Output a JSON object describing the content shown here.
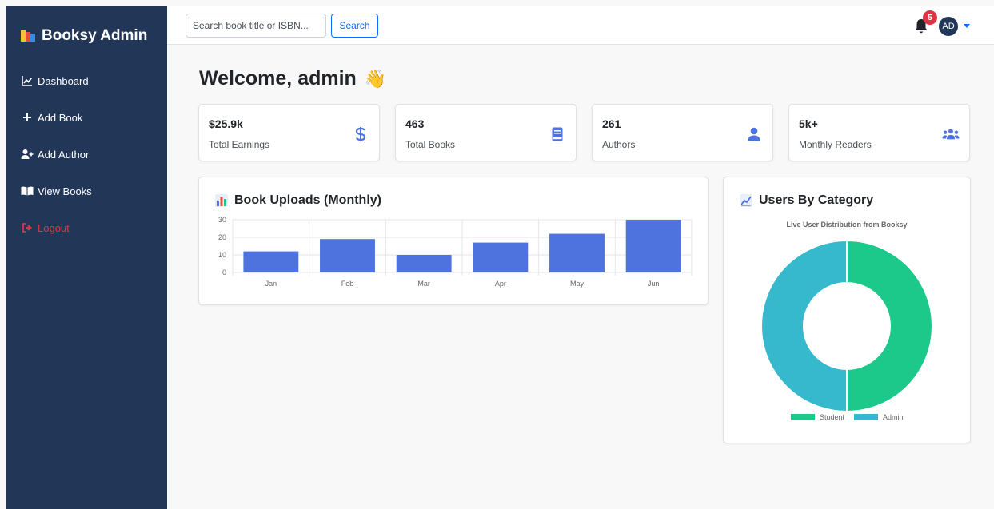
{
  "brand": {
    "name": "Booksy Admin"
  },
  "sidebar": {
    "items": [
      {
        "label": "Dashboard",
        "icon": "chart-line-icon"
      },
      {
        "label": "Add Book",
        "icon": "plus-icon"
      },
      {
        "label": "Add Author",
        "icon": "user-plus-icon"
      },
      {
        "label": "View Books",
        "icon": "book-open-icon"
      },
      {
        "label": "Logout",
        "icon": "logout-icon"
      }
    ]
  },
  "topbar": {
    "search_placeholder": "Search book title or ISBN...",
    "search_button": "Search",
    "notification_count": "5",
    "avatar_initials": "AD"
  },
  "welcome": {
    "text": "Welcome, admin",
    "emoji": "👋"
  },
  "stats": [
    {
      "value": "$25.9k",
      "label": "Total Earnings",
      "icon": "dollar-icon"
    },
    {
      "value": "463",
      "label": "Total Books",
      "icon": "book-icon"
    },
    {
      "value": "261",
      "label": "Authors",
      "icon": "user-icon"
    },
    {
      "value": "5k+",
      "label": "Monthly Readers",
      "icon": "users-icon"
    }
  ],
  "colors": {
    "sidebar": "#223658",
    "primary": "#0d6efd",
    "bar": "#4e73df",
    "stat_icon": "#4e73df",
    "student": "#1cc88a",
    "admin": "#36b9cc",
    "danger": "#dc3545"
  },
  "bar_panel": {
    "title": "Book Uploads (Monthly)"
  },
  "donut_panel": {
    "title": "Users By Category"
  },
  "chart_data": [
    {
      "type": "bar",
      "title": "Book Uploads (Monthly)",
      "categories": [
        "Jan",
        "Feb",
        "Mar",
        "Apr",
        "May",
        "Jun"
      ],
      "values": [
        12,
        19,
        10,
        17,
        22,
        30
      ],
      "ylim": [
        0,
        30
      ],
      "yticks": [
        0,
        10,
        20,
        30
      ],
      "grid": true
    },
    {
      "type": "pie",
      "donut": true,
      "title": "Live User Distribution from Booksy",
      "labels": [
        "Student",
        "Admin"
      ],
      "values": [
        50,
        50
      ],
      "legend": "bottom"
    }
  ]
}
